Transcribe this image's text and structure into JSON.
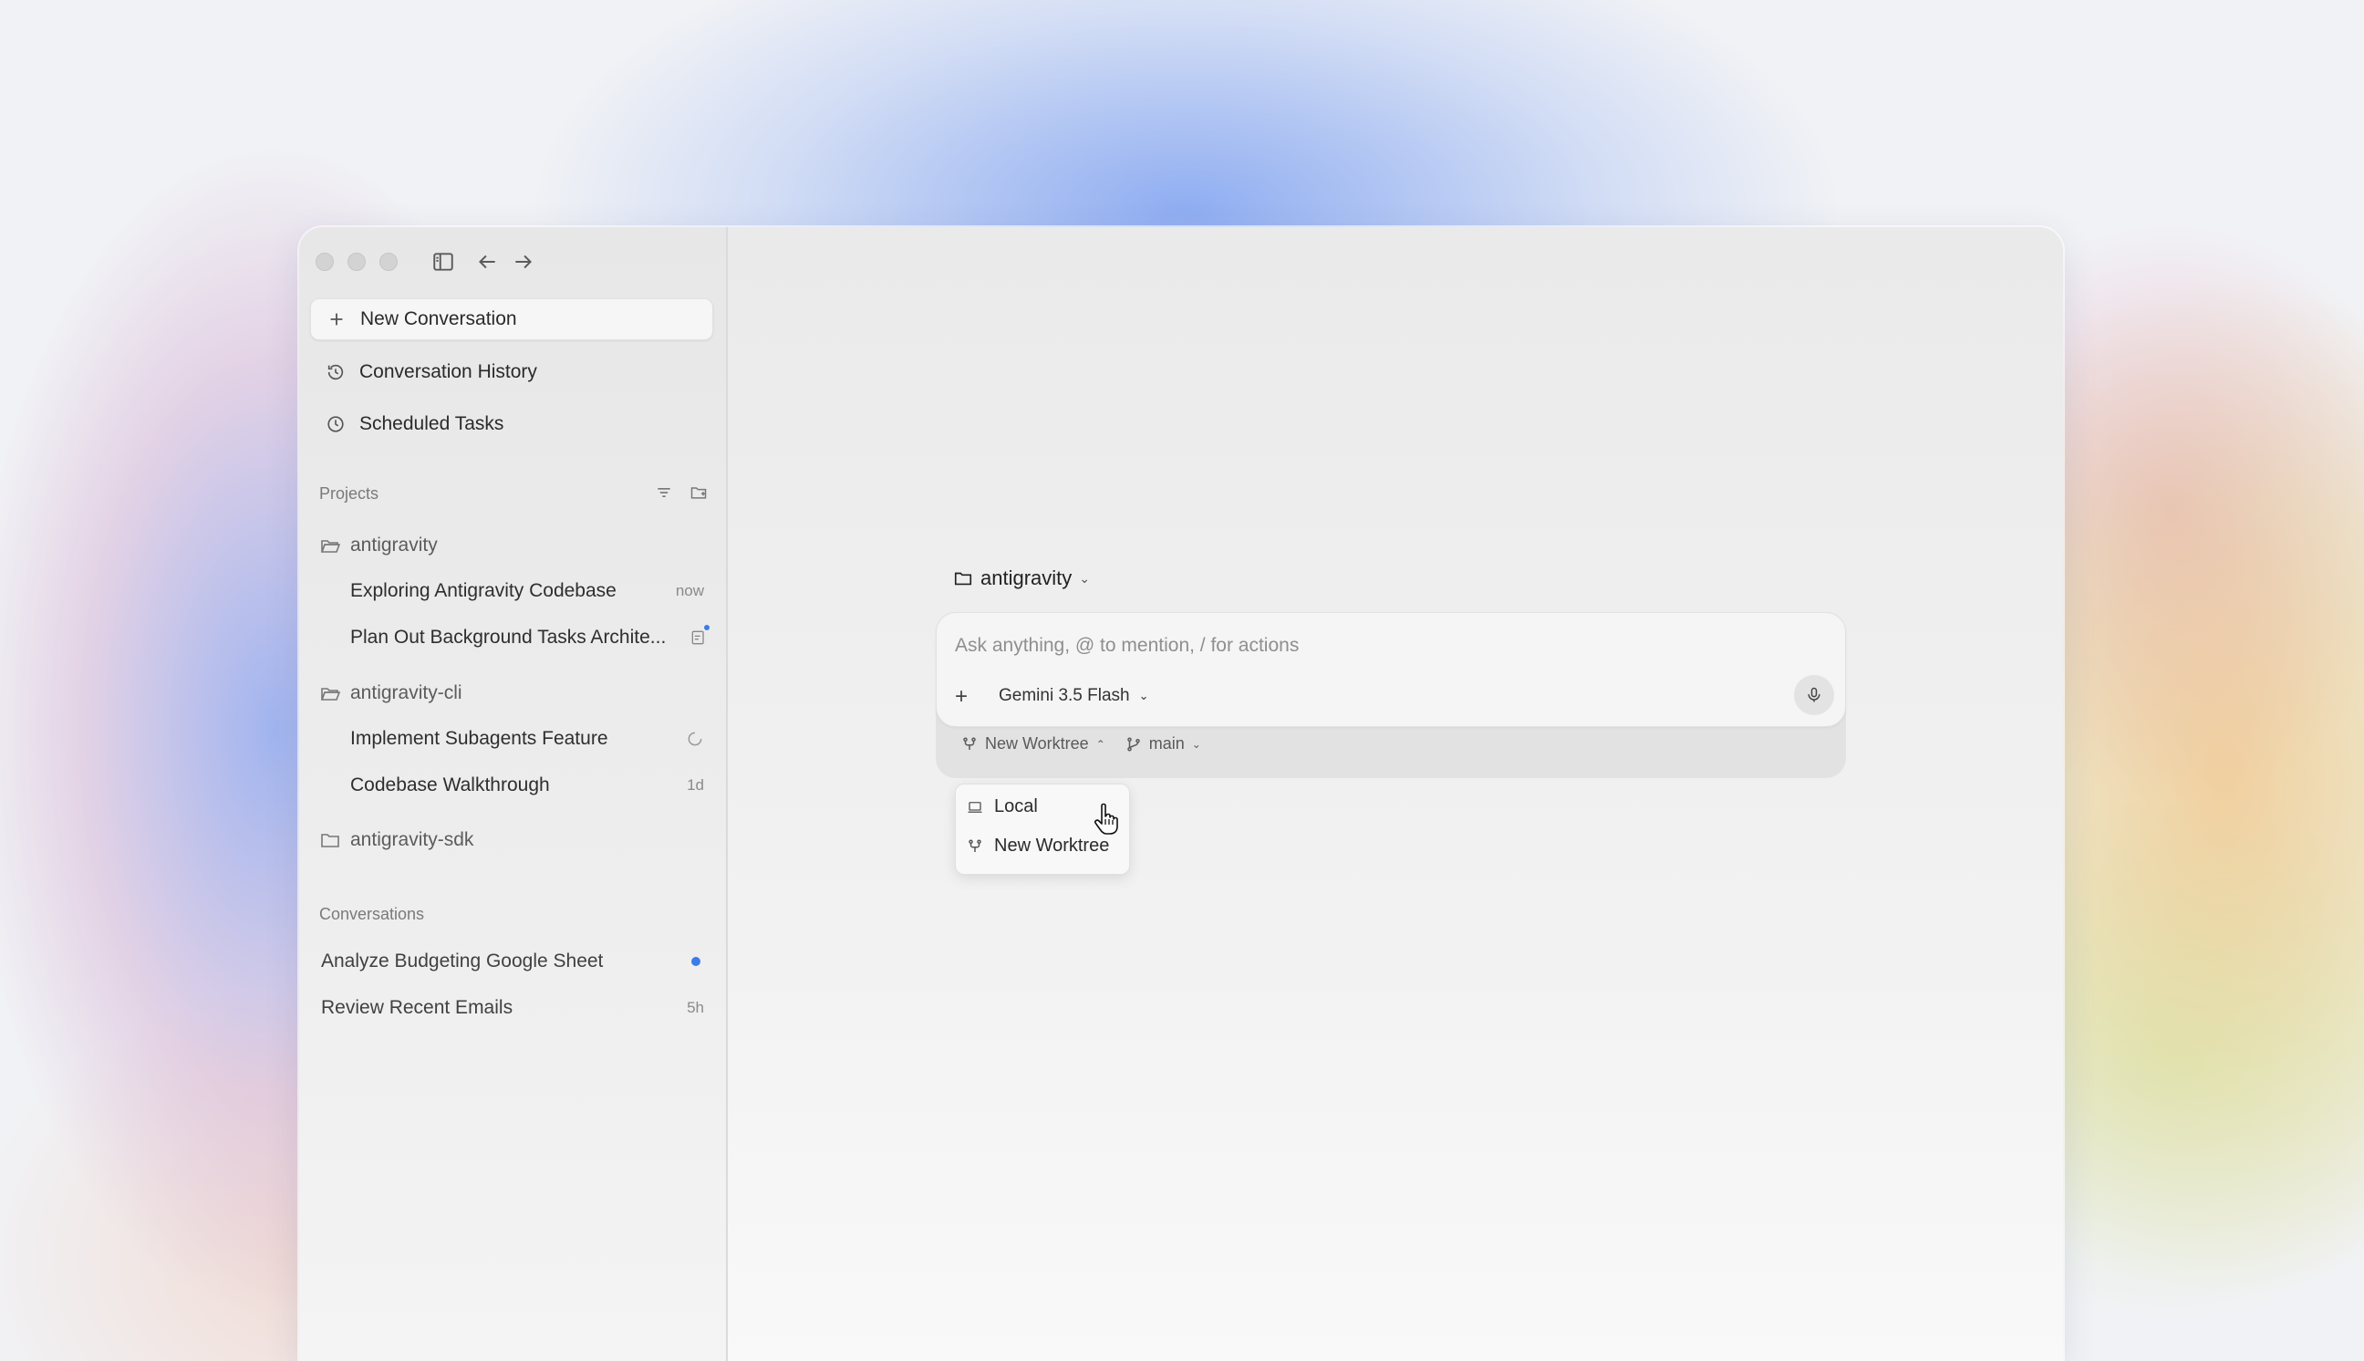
{
  "sidebar": {
    "new_conversation": "New Conversation",
    "conversation_history": "Conversation History",
    "scheduled_tasks": "Scheduled Tasks",
    "projects_label": "Projects",
    "projects": [
      {
        "name": "antigravity",
        "items": [
          {
            "title": "Exploring Antigravity Codebase",
            "meta": "now"
          },
          {
            "title": "Plan Out Background Tasks Archite...",
            "meta": ""
          }
        ]
      },
      {
        "name": "antigravity-cli",
        "items": [
          {
            "title": "Implement Subagents Feature",
            "meta": ""
          },
          {
            "title": "Codebase Walkthrough",
            "meta": "1d"
          }
        ]
      },
      {
        "name": "antigravity-sdk",
        "items": []
      }
    ],
    "conversations_label": "Conversations",
    "conversations": [
      {
        "title": "Analyze Budgeting Google Sheet",
        "meta": ""
      },
      {
        "title": "Review Recent Emails",
        "meta": "5h"
      }
    ]
  },
  "main": {
    "project": "antigravity",
    "composer": {
      "placeholder": "Ask anything, @ to mention, / for actions",
      "model": "Gemini 3.5 Flash"
    },
    "worktree": "New Worktree",
    "branch": "main",
    "menu": [
      {
        "label": "Local",
        "icon": "laptop-icon"
      },
      {
        "label": "New Worktree",
        "icon": "worktree-icon"
      }
    ]
  },
  "colors": {
    "accent": "#3b7de8"
  }
}
